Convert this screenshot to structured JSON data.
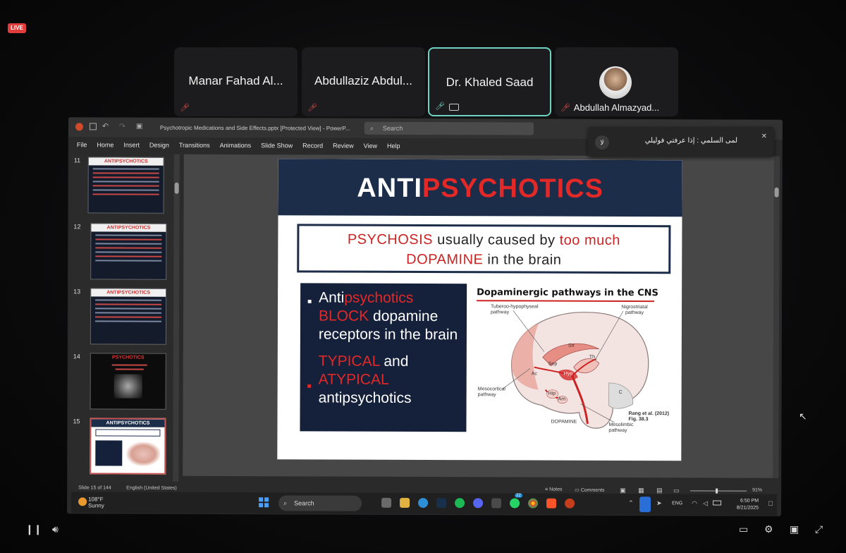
{
  "meeting": {
    "live_badge": "LIVE",
    "participants": [
      {
        "name": "Manar Fahad Al..."
      },
      {
        "name": "Abdullaziz Abdul..."
      },
      {
        "name": "Dr. Khaled Saad"
      },
      {
        "name": "Abdullah Almazyad..."
      }
    ]
  },
  "notification": {
    "avatar_text": "لا",
    "message": "لمى السلمي : إذا عرفتي فوليلي"
  },
  "powerpoint": {
    "doc_title": "Psychotropic Medications and Side Effects.pptx [Protected View] - PowerP...",
    "search_placeholder": "Search",
    "menu": [
      "File",
      "Home",
      "Insert",
      "Design",
      "Transitions",
      "Animations",
      "Slide Show",
      "Record",
      "Review",
      "View",
      "Help"
    ],
    "thumbnails": [
      {
        "num": "11",
        "title": "ANTIPSYCHOTICS"
      },
      {
        "num": "12",
        "title": "ANTIPSYCHOTICS"
      },
      {
        "num": "13",
        "title": "ANTIPSYCHOTICS"
      },
      {
        "num": "14",
        "title": "PSYCHOTICS"
      },
      {
        "num": "15",
        "title": "ANTIPSYCHOTICS"
      }
    ],
    "status": {
      "slide_info": "Slide 15 of 144",
      "language": "English (United States)",
      "notes": "Notes",
      "comments": "Comments",
      "zoom": "91%"
    }
  },
  "slide": {
    "title_white": "ANTI",
    "title_red": "PSYCHOTICS",
    "box_red1": "PSYCHOSIS",
    "box_text1": " usually caused by ",
    "box_red2": "too much",
    "box_red3": "DOPAMINE",
    "box_text2": " in the brain",
    "bullet1_a": "Anti",
    "bullet1_b": "psychotics",
    "bullet1_red": "BLOCK",
    "bullet1_rest": " dopamine receptors in the brain",
    "bullet2_red1": "TYPICAL",
    "bullet2_and": " and",
    "bullet2_red2": "ATYPICAL",
    "bullet2_rest": "antipsychotics",
    "diagram_title": "Dopaminergic pathways in the CNS",
    "labels": {
      "tubero": "Tuberoo-hypophyseal pathway",
      "nigro": "Nigrostriatal pathway",
      "meso_cort": "Mesocortical pathway",
      "mesolimbic": "Mesolimbic pathway",
      "dopamine": "DOPAMINE",
      "cite": "Rang et al. (2012) Fig. 38.3",
      "str": "Str",
      "th": "Th",
      "sep": "Sep",
      "hyp": "Hyp",
      "ac": "Ac",
      "hip": "Hip",
      "am": "Am",
      "c": "C"
    }
  },
  "taskbar": {
    "temperature": "108°F",
    "weather": "Sunny",
    "search": "Search",
    "language": "ENG",
    "time": "6:50 PM",
    "date": "8/21/2025",
    "whatsapp_badge": "22"
  }
}
